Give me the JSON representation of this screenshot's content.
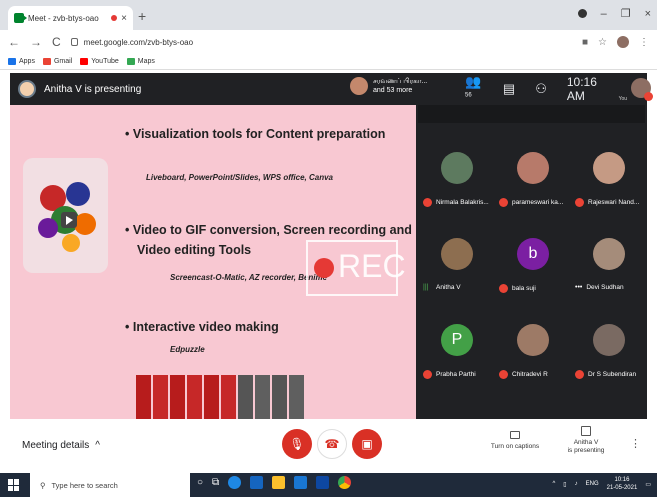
{
  "browser": {
    "tab_title": "Meet - zvb-btys-oao",
    "tab_close": "×",
    "new_tab": "+",
    "url": "meet.google.com/zvb-btys-oao",
    "window_controls": [
      "–",
      "❐",
      "×"
    ],
    "bookmarks": [
      {
        "label": "Apps",
        "color": "#1a73e8"
      },
      {
        "label": "Gmail",
        "color": "#ea4335"
      },
      {
        "label": "YouTube",
        "color": "#ff0000"
      },
      {
        "label": "Maps",
        "color": "#34a853"
      }
    ]
  },
  "meet": {
    "presenting_label": "Anitha V is presenting",
    "pinned_name": "சரவணப் பிரகா...",
    "pinned_more": "and 53 more",
    "count_badge": "56",
    "clock": "10:16 AM",
    "you_label": "You"
  },
  "slide": {
    "bullets": [
      "• Visualization tools for Content preparation",
      "• Video to GIF conversion, Screen recording and",
      "• Interactive video making"
    ],
    "bullet2_line2": "Video editing Tools",
    "subs": [
      "Liveboard, PowerPoint/Slides, WPS office, Canva",
      "Screencast-O-Matic, AZ recorder, Benime",
      "Edpuzzle"
    ],
    "rec_label": "REC"
  },
  "participants": [
    {
      "name": "Nirmala Balakris...",
      "status": "muted",
      "color": "#5d7a5f"
    },
    {
      "name": "parameswari ka...",
      "status": "muted",
      "color": "#b77a6a"
    },
    {
      "name": "Rajeswari Nand...",
      "status": "muted",
      "color": "#c59a84"
    },
    {
      "name": "Anitha V",
      "status": "speaking",
      "color": "#8d6e50"
    },
    {
      "name": "bala suji",
      "status": "muted",
      "color": "#7b1fa2",
      "letter": "b"
    },
    {
      "name": "Devi Sudhan",
      "status": "more",
      "color": "#a58c7a"
    },
    {
      "name": "Prabha Parthi",
      "status": "muted",
      "color": "#43a047",
      "letter": "P"
    },
    {
      "name": "Chitradevi R",
      "status": "muted",
      "color": "#9d7a66"
    },
    {
      "name": "Dr S Subendiran",
      "status": "muted",
      "color": "#7a6a62"
    }
  ],
  "controls": {
    "meeting_details": "Meeting details",
    "captions_label": "Turn on captions",
    "present_line1": "Anitha V",
    "present_line2": "is presenting",
    "more": "⋮"
  },
  "taskbar": {
    "search_placeholder": "Type here to search",
    "time": "10:16",
    "date": "21-05-2021",
    "lang": "ENG"
  }
}
